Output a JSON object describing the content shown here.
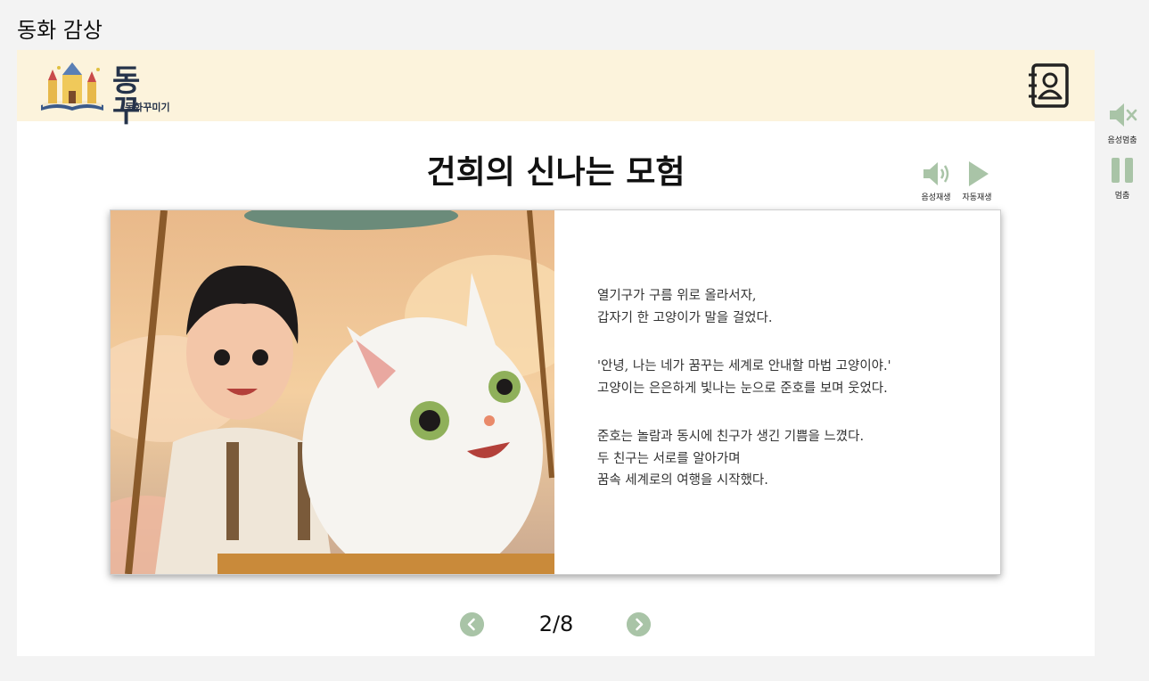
{
  "page": {
    "heading": "동화 감상"
  },
  "header": {
    "logo_title": "동 꾸",
    "logo_subtitle": "동화꾸미기",
    "contact_icon": "contact-book-icon"
  },
  "story": {
    "title": "건희의 신나는 모험",
    "controls": {
      "voice_play_label": "음성재생",
      "auto_play_label": "자동재생"
    },
    "paragraphs": [
      {
        "lines": [
          "열기구가 구름 위로 올라서자,",
          "갑자기 한 고양이가 말을 걸었다."
        ]
      },
      {
        "lines": [
          "'안녕, 나는 네가 꿈꾸는 세계로 안내할 마법 고양이야.'",
          "고양이는 은은하게 빛나는 눈으로 준호를 보며 웃었다."
        ]
      },
      {
        "lines": [
          "준호는 놀람과 동시에 친구가 생긴 기쁨을 느꼈다.",
          "두 친구는 서로를 알아가며",
          "꿈속 세계로의 여행을 시작했다."
        ]
      }
    ],
    "illustration": "boy-and-white-cat-in-hot-air-balloon"
  },
  "pagination": {
    "current": "2/8",
    "prev_icon": "chevron-left-icon",
    "next_icon": "chevron-right-icon"
  },
  "side_controls": {
    "mute_label": "음성멈춤",
    "pause_label": "멈춤"
  },
  "colors": {
    "accent_green": "#a9c4a7",
    "header_bg": "#fcf3dc",
    "logo_text": "#25334a"
  }
}
